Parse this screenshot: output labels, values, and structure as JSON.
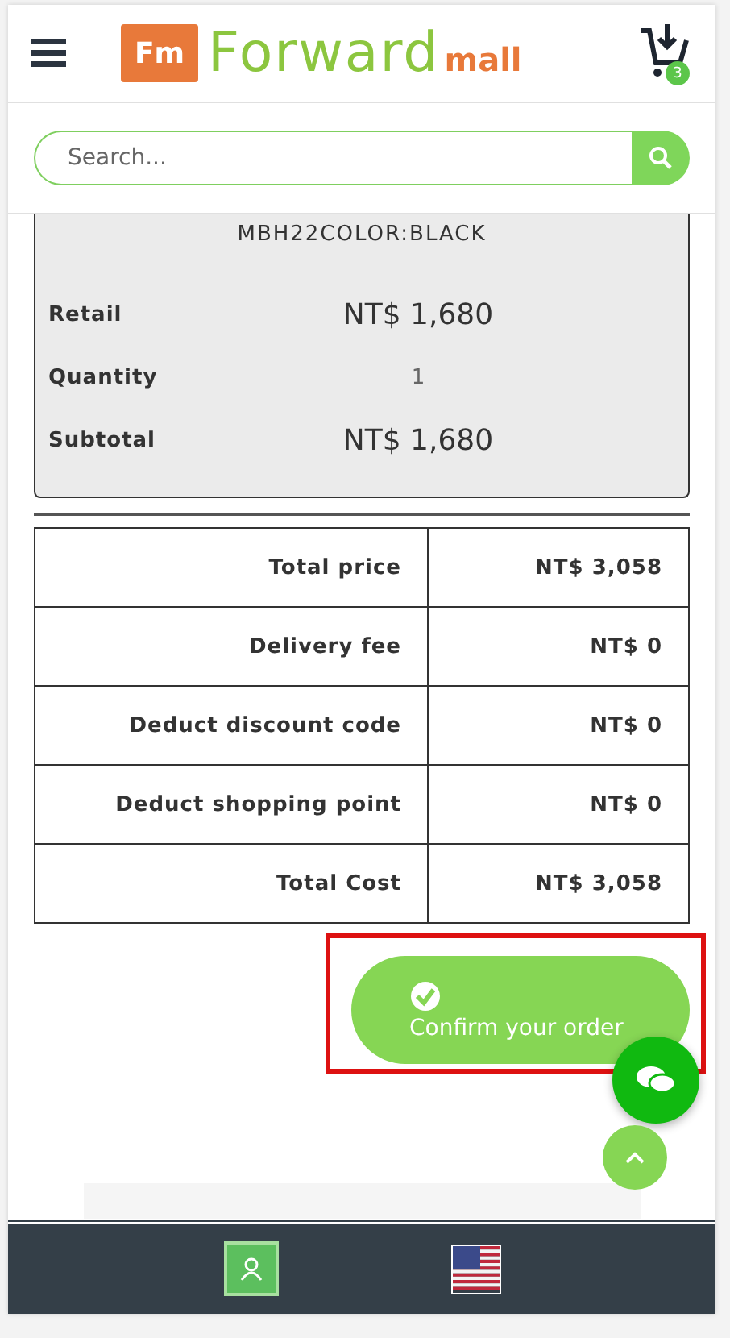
{
  "header": {
    "logo": {
      "badge": "Fm",
      "word": "Forward",
      "suffix": "mall"
    },
    "cart_count": "3"
  },
  "search": {
    "placeholder": "Search..."
  },
  "item": {
    "variant": "MBH22COLOR:BLACK",
    "rows": [
      {
        "kind": "price",
        "label": "Retail",
        "value": "NT$ 1,680"
      },
      {
        "kind": "plain",
        "label": "Quantity",
        "value": "1"
      },
      {
        "kind": "price",
        "label": "Subtotal",
        "value": "NT$ 1,680"
      }
    ]
  },
  "summary": [
    {
      "label": "Total price",
      "value": "NT$ 3,058"
    },
    {
      "label": "Delivery fee",
      "value": "NT$ 0"
    },
    {
      "label": "Deduct discount code",
      "value": "NT$ 0"
    },
    {
      "label": "Deduct shopping point",
      "value": "NT$ 0"
    },
    {
      "label": "Total Cost",
      "value": "NT$ 3,058"
    }
  ],
  "confirm_button": {
    "label": "Confirm your order",
    "highlighted": true
  }
}
